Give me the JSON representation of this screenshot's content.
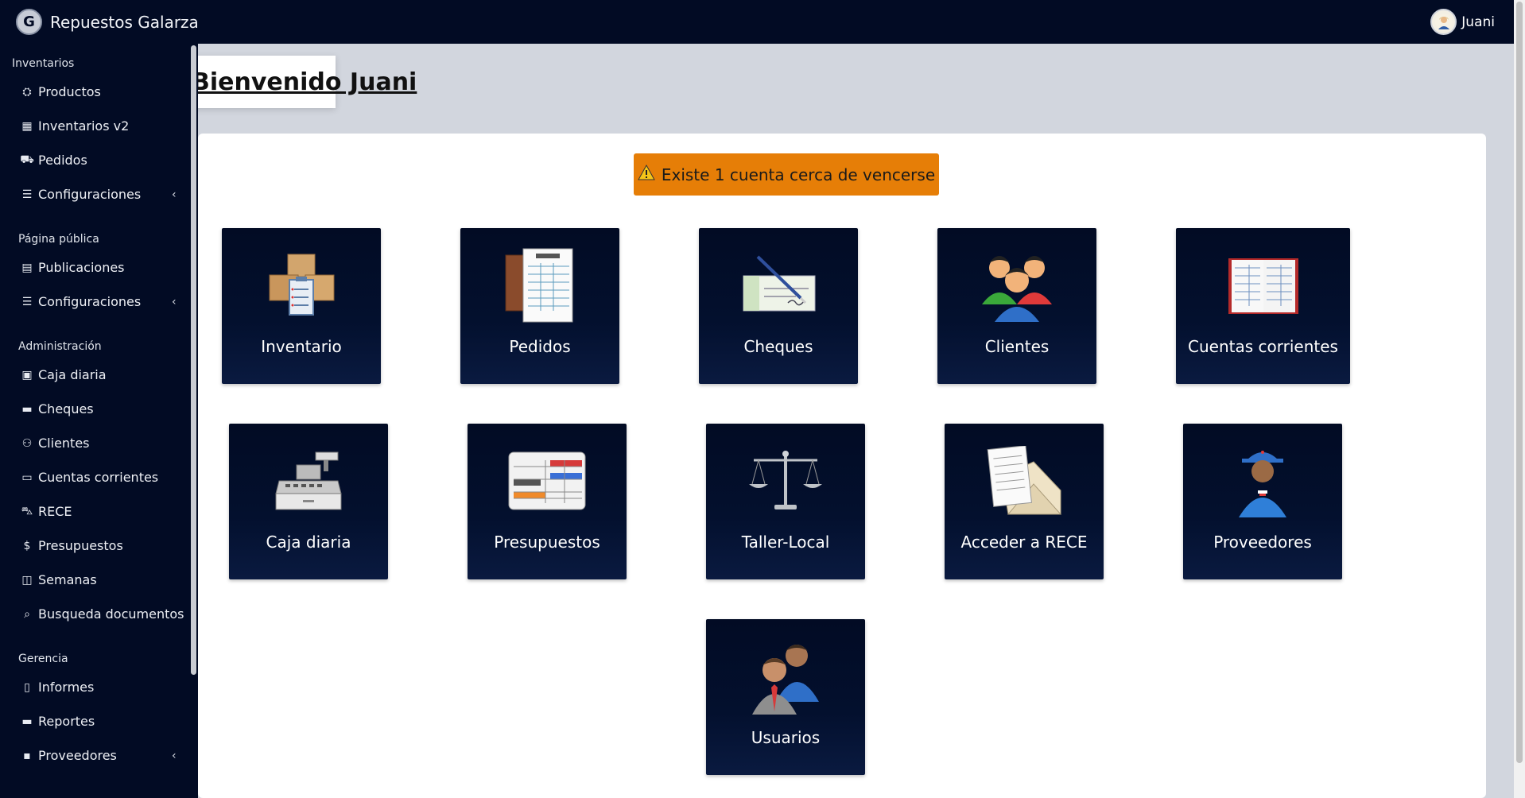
{
  "navbar": {
    "brand": "Repuestos Galarza",
    "logo_letter": "G",
    "user": "Juani"
  },
  "sidebar": {
    "sections": [
      {
        "title": "Inventarios",
        "items": [
          {
            "label": "Productos",
            "icon": "cubes-icon",
            "glyph": "⛭"
          },
          {
            "label": "Inventarios v2",
            "icon": "grid-icon",
            "glyph": "▦"
          },
          {
            "label": "Pedidos",
            "icon": "truck-icon",
            "glyph": "⛟"
          },
          {
            "label": "Configuraciones",
            "icon": "sliders-icon",
            "glyph": "☰",
            "chevron": "‹"
          }
        ]
      },
      {
        "title": "Página pública",
        "items": [
          {
            "label": "Publicaciones",
            "icon": "store-icon",
            "glyph": "▤"
          },
          {
            "label": "Configuraciones",
            "icon": "sliders-icon",
            "glyph": "☰",
            "chevron": "‹"
          }
        ]
      },
      {
        "title": "Administración",
        "items": [
          {
            "label": "Caja diaria",
            "icon": "cash-register-icon",
            "glyph": "▣"
          },
          {
            "label": "Cheques",
            "icon": "money-check-icon",
            "glyph": "▬"
          },
          {
            "label": "Clientes",
            "icon": "users-icon",
            "glyph": "⚇"
          },
          {
            "label": "Cuentas corrientes",
            "icon": "folder-open-icon",
            "glyph": "▭"
          },
          {
            "label": "RECE",
            "icon": "cart-icon",
            "glyph": "⛍"
          },
          {
            "label": "Presupuestos",
            "icon": "dollar-icon",
            "glyph": "$"
          },
          {
            "label": "Semanas",
            "icon": "columns-icon",
            "glyph": "◫"
          },
          {
            "label": "Busqueda documentos",
            "icon": "search-icon",
            "glyph": "⌕"
          }
        ]
      },
      {
        "title": "Gerencia",
        "items": [
          {
            "label": "Informes",
            "icon": "file-icon",
            "glyph": "▯"
          },
          {
            "label": "Reportes",
            "icon": "money-check-icon",
            "glyph": "▬"
          },
          {
            "label": "Proveedores",
            "icon": "id-badge-icon",
            "glyph": "▪",
            "chevron": "‹"
          }
        ]
      }
    ]
  },
  "welcome": {
    "text": "Bienvenido Juani"
  },
  "alert": {
    "text": "Existe 1 cuenta cerca de vencerse",
    "color": "#e67e07"
  },
  "tiles": [
    {
      "label": "Inventario",
      "icon": "boxes-clipboard-icon"
    },
    {
      "label": "Pedidos",
      "icon": "order-form-icon"
    },
    {
      "label": "Cheques",
      "icon": "check-pen-icon"
    },
    {
      "label": "Clientes",
      "icon": "customers-group-icon"
    },
    {
      "label": "Cuentas corrientes",
      "icon": "ledger-book-icon"
    },
    {
      "label": "Caja diaria",
      "icon": "cash-register-icon"
    },
    {
      "label": "Presupuestos",
      "icon": "quote-table-icon"
    },
    {
      "label": "Taller-Local",
      "icon": "balance-scale-icon"
    },
    {
      "label": "Acceder a RECE",
      "icon": "receipt-envelope-icon"
    },
    {
      "label": "Proveedores",
      "icon": "delivery-man-icon"
    },
    {
      "label": "Usuarios",
      "icon": "business-users-icon"
    }
  ]
}
